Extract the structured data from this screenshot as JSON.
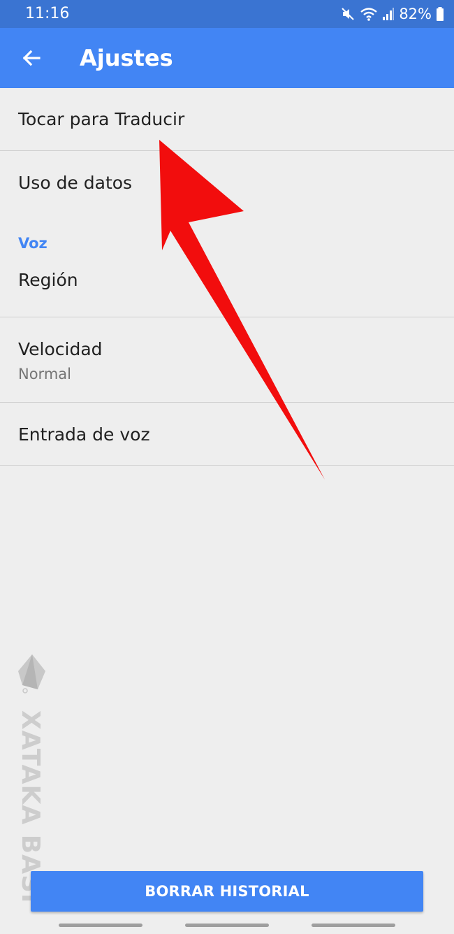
{
  "status_bar": {
    "time": "11:16",
    "battery": "82%",
    "icons": [
      "mute-icon",
      "wifi-icon",
      "signal-icon",
      "battery-icon"
    ]
  },
  "app_bar": {
    "title": "Ajustes",
    "back_icon": "arrow-back-icon"
  },
  "settings": {
    "items": [
      {
        "label": "Tocar para Traducir"
      },
      {
        "label": "Uso de datos"
      }
    ],
    "voice_section": {
      "header": "Voz",
      "items": [
        {
          "label": "Región"
        },
        {
          "label": "Velocidad",
          "value": "Normal"
        },
        {
          "label": "Entrada de voz"
        }
      ]
    }
  },
  "clear_history_button": "BORRAR HISTORIAL",
  "watermark_text": "XATAKA BASICS",
  "colors": {
    "status_bar": "#3a74d2",
    "app_bar": "#4285f4",
    "accent": "#4285f4",
    "background": "#eeeeee",
    "annotation_arrow": "#f20d0d"
  }
}
